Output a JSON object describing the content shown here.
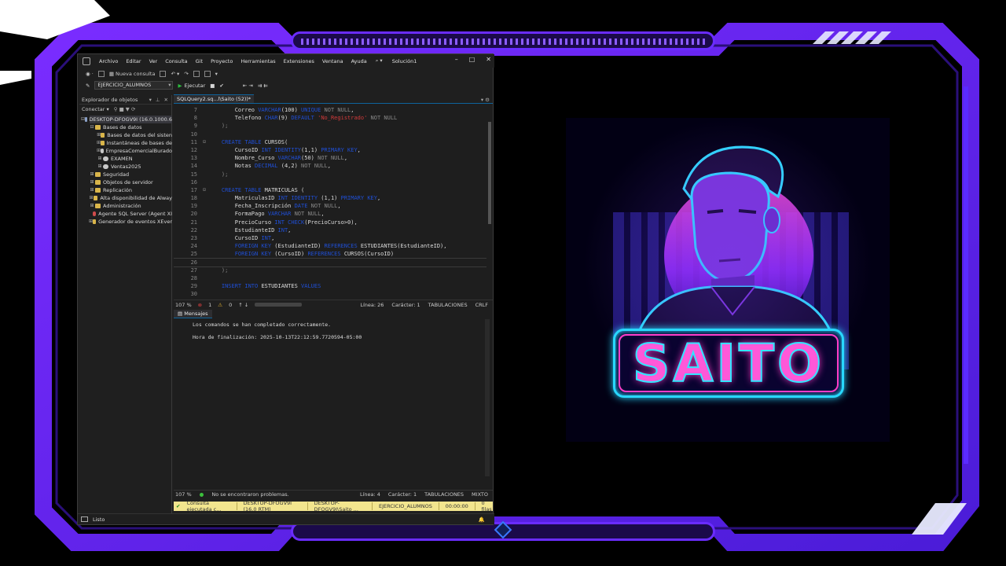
{
  "menu": {
    "items": [
      "Archivo",
      "Editar",
      "Ver",
      "Consulta",
      "Git",
      "Proyecto",
      "Herramientas",
      "Extensiones",
      "Ventana",
      "Ayuda"
    ],
    "search_icon": "search-icon",
    "solution": "Solución1"
  },
  "toolbar": {
    "new_query": "Nueva consulta",
    "database": "EJERCICIO_ALUMNOS",
    "execute": "Ejecutar"
  },
  "object_explorer": {
    "title": "Explorador de objetos",
    "connect": "Conectar ▾",
    "tree": [
      {
        "label": "DESKTOP-DFOGV9I (16.0.1000.6",
        "level": 0,
        "expander": "⊟",
        "icon": "server"
      },
      {
        "label": "Bases de datos",
        "level": 1,
        "expander": "⊟",
        "icon": "folder"
      },
      {
        "label": "Bases de datos del sisten",
        "level": 2,
        "expander": "⊞",
        "icon": "folder"
      },
      {
        "label": "Instantáneas de bases de",
        "level": 2,
        "expander": "⊞",
        "icon": "folder"
      },
      {
        "label": "EmpresaComercialBurado",
        "level": 2,
        "expander": "⊞",
        "icon": "db"
      },
      {
        "label": "EXAMEN",
        "level": 2,
        "expander": "⊞",
        "icon": "db"
      },
      {
        "label": "Ventas2025",
        "level": 2,
        "expander": "⊞",
        "icon": "db"
      },
      {
        "label": "Seguridad",
        "level": 1,
        "expander": "⊞",
        "icon": "folder"
      },
      {
        "label": "Objetos de servidor",
        "level": 1,
        "expander": "⊞",
        "icon": "folder"
      },
      {
        "label": "Replicación",
        "level": 1,
        "expander": "⊞",
        "icon": "folder"
      },
      {
        "label": "Alta disponibilidad de Alway",
        "level": 1,
        "expander": "⊞",
        "icon": "folder"
      },
      {
        "label": "Administración",
        "level": 1,
        "expander": "⊞",
        "icon": "folder"
      },
      {
        "label": "Agente SQL Server (Agent XI",
        "level": 1,
        "expander": "",
        "icon": "agent"
      },
      {
        "label": "Generador de eventos XEver",
        "level": 1,
        "expander": "⊞",
        "icon": "folder"
      }
    ]
  },
  "editor": {
    "tab_label": "SQLQuery2.sq...l\\Saito (52))*",
    "lines": [
      {
        "n": "7",
        "fold": "",
        "parts": [
          [
            "txt",
            "        Correo "
          ],
          [
            "kw",
            "VARCHAR"
          ],
          [
            "txt",
            "(100) "
          ],
          [
            "kw",
            "UNIQUE"
          ],
          [
            "gray",
            " NOT NULL"
          ],
          [
            "txt",
            ","
          ]
        ]
      },
      {
        "n": "8",
        "fold": "",
        "parts": [
          [
            "txt",
            "        Telefono "
          ],
          [
            "kw",
            "CHAR"
          ],
          [
            "txt",
            "(9) "
          ],
          [
            "kw",
            "DEFAULT"
          ],
          [
            "txt",
            " "
          ],
          [
            "str",
            "'No_Registrado'"
          ],
          [
            "gray",
            " NOT NULL"
          ]
        ]
      },
      {
        "n": "9",
        "fold": "",
        "parts": [
          [
            "gray",
            "    );"
          ]
        ]
      },
      {
        "n": "10",
        "fold": "",
        "parts": [
          [
            "txt",
            ""
          ]
        ]
      },
      {
        "n": "11",
        "fold": "⊟",
        "parts": [
          [
            "kw",
            "    CREATE TABLE "
          ],
          [
            "txt",
            "CURSOS("
          ]
        ]
      },
      {
        "n": "12",
        "fold": "",
        "parts": [
          [
            "txt",
            "        CursoID "
          ],
          [
            "kw",
            "INT IDENTITY"
          ],
          [
            "txt",
            "(1,1) "
          ],
          [
            "kw",
            "PRIMARY KEY"
          ],
          [
            "txt",
            ","
          ]
        ]
      },
      {
        "n": "13",
        "fold": "",
        "parts": [
          [
            "txt",
            "        Nombre_Curso "
          ],
          [
            "kw",
            "VARCHAR"
          ],
          [
            "txt",
            "(50)"
          ],
          [
            "gray",
            " NOT NULL"
          ],
          [
            "txt",
            ","
          ]
        ]
      },
      {
        "n": "14",
        "fold": "",
        "parts": [
          [
            "txt",
            "        Notas "
          ],
          [
            "kw",
            "DECIMAL"
          ],
          [
            "txt",
            " (4,2)"
          ],
          [
            "gray",
            " NOT NULL"
          ],
          [
            "txt",
            ","
          ]
        ]
      },
      {
        "n": "15",
        "fold": "",
        "parts": [
          [
            "gray",
            "    );"
          ]
        ]
      },
      {
        "n": "16",
        "fold": "",
        "parts": [
          [
            "txt",
            ""
          ]
        ]
      },
      {
        "n": "17",
        "fold": "⊟",
        "parts": [
          [
            "kw",
            "    CREATE TABLE "
          ],
          [
            "txt",
            "MATRICULAS ("
          ]
        ]
      },
      {
        "n": "18",
        "fold": "",
        "parts": [
          [
            "txt",
            "        MatriculasID "
          ],
          [
            "kw",
            "INT IDENTITY"
          ],
          [
            "txt",
            " (1,1) "
          ],
          [
            "kw",
            "PRIMARY KEY"
          ],
          [
            "txt",
            ","
          ]
        ]
      },
      {
        "n": "19",
        "fold": "",
        "parts": [
          [
            "txt",
            "        Fecha_Inscripción "
          ],
          [
            "kw",
            "DATE"
          ],
          [
            "gray",
            " NOT NULL"
          ],
          [
            "txt",
            ","
          ]
        ]
      },
      {
        "n": "20",
        "fold": "",
        "parts": [
          [
            "txt",
            "        FormaPago "
          ],
          [
            "kw",
            "VARCHAR"
          ],
          [
            "gray",
            " NOT NULL"
          ],
          [
            "txt",
            ","
          ]
        ]
      },
      {
        "n": "21",
        "fold": "",
        "parts": [
          [
            "txt",
            "        PrecioCurso "
          ],
          [
            "kw",
            "INT CHECK"
          ],
          [
            "txt",
            "(PrecioCurso>0),"
          ]
        ]
      },
      {
        "n": "22",
        "fold": "",
        "parts": [
          [
            "txt",
            "        EstudianteID "
          ],
          [
            "kw",
            "INT"
          ],
          [
            "txt",
            ","
          ]
        ]
      },
      {
        "n": "23",
        "fold": "",
        "parts": [
          [
            "txt",
            "        CursoID "
          ],
          [
            "kw",
            "INT"
          ],
          [
            "txt",
            ","
          ]
        ]
      },
      {
        "n": "24",
        "fold": "",
        "parts": [
          [
            "kw",
            "        FOREIGN KEY "
          ],
          [
            "txt",
            "(EstudianteID) "
          ],
          [
            "kw",
            "REFERENCES"
          ],
          [
            "txt",
            " ESTUDIANTES(EstudianteID),"
          ]
        ]
      },
      {
        "n": "25",
        "fold": "",
        "parts": [
          [
            "kw",
            "        FOREIGN KEY "
          ],
          [
            "txt",
            "(CursoID) "
          ],
          [
            "kw",
            "REFERENCES"
          ],
          [
            "txt",
            " CURSOS(CursoID)"
          ]
        ]
      },
      {
        "n": "26",
        "fold": "",
        "parts": [
          [
            "txt",
            ""
          ]
        ],
        "current": true
      },
      {
        "n": "27",
        "fold": "",
        "parts": [
          [
            "gray",
            "    );"
          ]
        ]
      },
      {
        "n": "28",
        "fold": "",
        "parts": [
          [
            "txt",
            ""
          ]
        ]
      },
      {
        "n": "29",
        "fold": "",
        "parts": [
          [
            "kw",
            "    INSERT INTO "
          ],
          [
            "txt",
            "ESTUDIANTES "
          ],
          [
            "kw",
            "VALUES"
          ]
        ]
      },
      {
        "n": "30",
        "fold": "",
        "parts": [
          [
            "txt",
            ""
          ]
        ]
      }
    ],
    "status": {
      "zoom": "107 %",
      "errors": "1",
      "warnings": "0",
      "line": "Línea: 26",
      "char": "Carácter: 1",
      "indent": "TABULACIONES",
      "eol": "CRLF"
    }
  },
  "messages": {
    "tab_label": "Mensajes",
    "lines": [
      "Los comandos se han completado correctamente.",
      "Hora de finalización: 2025-10-13T22:12:59.7720594-05:00"
    ],
    "status": {
      "zoom": "107 %",
      "problems": "No se encontraron problemas.",
      "line": "Línea: 4",
      "char": "Carácter: 1",
      "indent": "TABULACIONES",
      "eol": "MIXTO"
    }
  },
  "query_status": {
    "result": "Consulta ejecutada c...",
    "server": "DESKTOP-DFOGV9I (16.0 RTM)",
    "user": "DESKTOP-DFOGV9I\\Saito ...",
    "database": "EJERCICIO_ALUMNOS",
    "time": "00:00:00",
    "rows": "0 filas"
  },
  "app_status": {
    "text": "Listo"
  },
  "logo": {
    "name": "SAITO"
  }
}
